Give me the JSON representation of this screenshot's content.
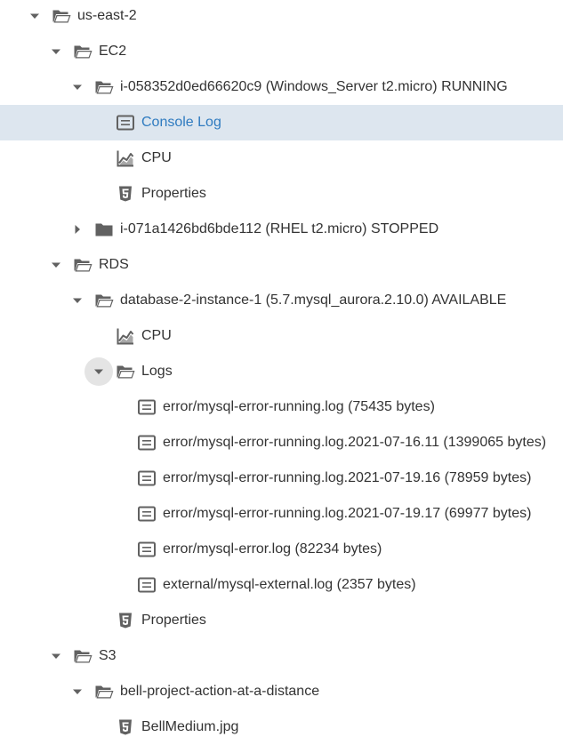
{
  "tree": {
    "region": {
      "label": "us-east-2"
    },
    "ec2": {
      "label": "EC2",
      "instance1": {
        "label": "i-058352d0ed66620c9 (Windows_Server t2.micro) RUNNING",
        "console_log": "Console Log",
        "cpu": "CPU",
        "properties": "Properties"
      },
      "instance2": {
        "label": "i-071a1426bd6bde112 (RHEL t2.micro) STOPPED"
      }
    },
    "rds": {
      "label": "RDS",
      "instance": {
        "label": "database-2-instance-1 (5.7.mysql_aurora.2.10.0) AVAILABLE",
        "cpu": "CPU",
        "logs": {
          "label": "Logs",
          "files": [
            "error/mysql-error-running.log (75435 bytes)",
            "error/mysql-error-running.log.2021-07-16.11 (1399065 bytes)",
            "error/mysql-error-running.log.2021-07-19.16 (78959 bytes)",
            "error/mysql-error-running.log.2021-07-19.17 (69977 bytes)",
            "error/mysql-error.log (82234 bytes)",
            "external/mysql-external.log (2357 bytes)"
          ]
        },
        "properties": "Properties"
      }
    },
    "s3": {
      "label": "S3",
      "bucket": {
        "label": "bell-project-action-at-a-distance",
        "file": "BellMedium.jpg"
      }
    }
  },
  "colors": {
    "selected_bg": "#dde6ef",
    "selected_text": "#2f7bc0",
    "text": "#333333",
    "icon": "#616161"
  },
  "icons": {
    "expanded": "caret-down-icon",
    "collapsed": "caret-right-icon",
    "folder_open": "folder-open-icon",
    "folder_closed": "folder-icon",
    "log": "log-file-icon",
    "cpu": "line-chart-icon",
    "properties": "html5-file-icon"
  }
}
